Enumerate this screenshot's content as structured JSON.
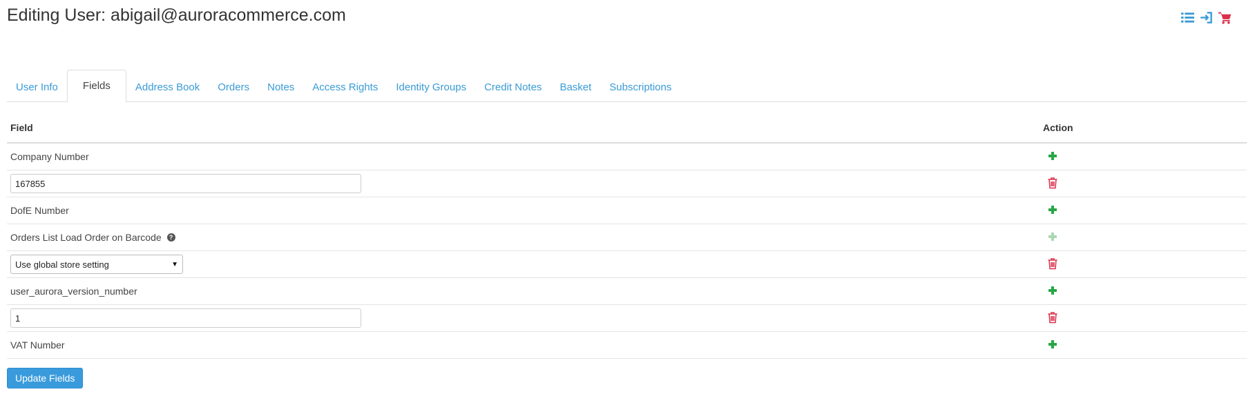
{
  "header": {
    "title": "Editing User: abigail@auroracommerce.com"
  },
  "top_icons": [
    {
      "name": "list-icon",
      "color": "#3a9bd5"
    },
    {
      "name": "login-icon",
      "color": "#3a9bd5"
    },
    {
      "name": "cart-icon",
      "color": "#d9304a"
    }
  ],
  "tabs": [
    {
      "label": "User Info",
      "active": false
    },
    {
      "label": "Fields",
      "active": true
    },
    {
      "label": "Address Book",
      "active": false
    },
    {
      "label": "Orders",
      "active": false
    },
    {
      "label": "Notes",
      "active": false
    },
    {
      "label": "Access Rights",
      "active": false
    },
    {
      "label": "Identity Groups",
      "active": false
    },
    {
      "label": "Credit Notes",
      "active": false
    },
    {
      "label": "Basket",
      "active": false
    },
    {
      "label": "Subscriptions",
      "active": false
    }
  ],
  "table": {
    "headers": {
      "field": "Field",
      "action": "Action"
    },
    "rows": {
      "company_number": {
        "label": "Company Number"
      },
      "company_number_value": {
        "value": "167855"
      },
      "dofe_number": {
        "label": "DofE Number"
      },
      "orders_list_load": {
        "label": "Orders List Load Order on Barcode"
      },
      "orders_list_load_value": {
        "selected": "Use global store setting"
      },
      "version_number": {
        "label": "user_aurora_version_number"
      },
      "version_number_value": {
        "value": "1"
      },
      "vat_number": {
        "label": "VAT Number"
      }
    }
  },
  "colors": {
    "accent": "#3a9bd5",
    "add": "#28a745",
    "add_disabled": "#a8d8b2",
    "delete": "#d9304a"
  },
  "footer": {
    "update_label": "Update Fields"
  }
}
